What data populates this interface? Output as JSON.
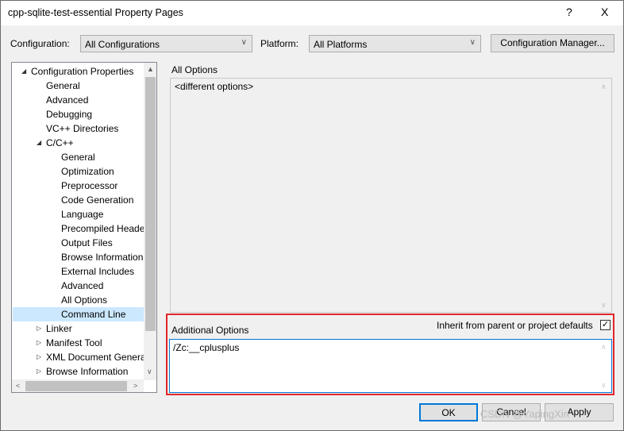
{
  "window": {
    "title": "cpp-sqlite-test-essential Property Pages",
    "help": "?",
    "close": "X"
  },
  "toolbar": {
    "configuration_label": "Configuration:",
    "configuration_value": "All Configurations",
    "platform_label": "Platform:",
    "platform_value": "All Platforms",
    "config_manager": "Configuration Manager..."
  },
  "tree": {
    "items": [
      {
        "label": "Configuration Properties",
        "level": 0,
        "expanded": true
      },
      {
        "label": "General",
        "level": 1
      },
      {
        "label": "Advanced",
        "level": 1
      },
      {
        "label": "Debugging",
        "level": 1
      },
      {
        "label": "VC++ Directories",
        "level": 1
      },
      {
        "label": "C/C++",
        "level": 1,
        "expanded": true
      },
      {
        "label": "General",
        "level": 2
      },
      {
        "label": "Optimization",
        "level": 2
      },
      {
        "label": "Preprocessor",
        "level": 2
      },
      {
        "label": "Code Generation",
        "level": 2
      },
      {
        "label": "Language",
        "level": 2
      },
      {
        "label": "Precompiled Heade",
        "level": 2
      },
      {
        "label": "Output Files",
        "level": 2
      },
      {
        "label": "Browse Information",
        "level": 2
      },
      {
        "label": "External Includes",
        "level": 2
      },
      {
        "label": "Advanced",
        "level": 2
      },
      {
        "label": "All Options",
        "level": 2
      },
      {
        "label": "Command Line",
        "level": 2,
        "selected": true
      },
      {
        "label": "Linker",
        "level": 1,
        "expanded": false
      },
      {
        "label": "Manifest Tool",
        "level": 1,
        "expanded": false
      },
      {
        "label": "XML Document Genera",
        "level": 1,
        "expanded": false
      },
      {
        "label": "Browse Information",
        "level": 1,
        "expanded": false
      }
    ]
  },
  "all_options": {
    "label": "All Options",
    "value": "<different options>"
  },
  "additional_options": {
    "label": "Additional Options",
    "inherit_label": "Inherit from parent or project defaults",
    "inherit_checked": true,
    "value": "/Zc:__cplusplus"
  },
  "buttons": {
    "ok": "OK",
    "cancel": "Cancel",
    "apply": "Apply"
  },
  "watermark": "CSDN @YapingXin",
  "colors": {
    "highlight": "#e3262b",
    "selection": "#cce8ff",
    "focus": "#0078d7"
  }
}
